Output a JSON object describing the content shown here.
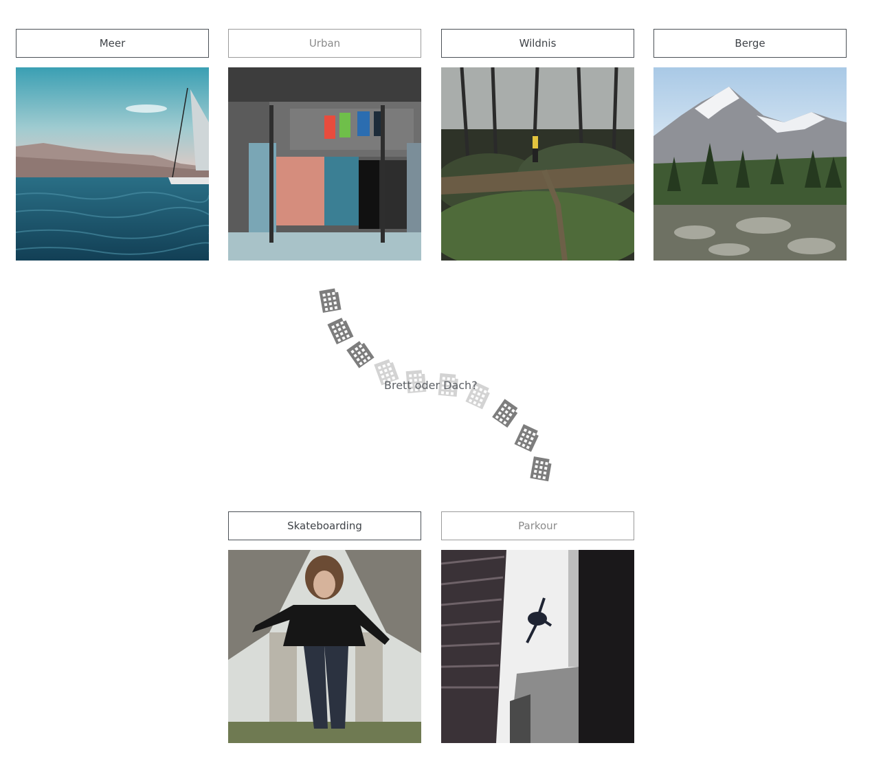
{
  "categories": {
    "meer": {
      "label": "Meer",
      "state": "active"
    },
    "urban": {
      "label": "Urban",
      "state": "muted"
    },
    "wildnis": {
      "label": "Wildnis",
      "state": "active"
    },
    "berge": {
      "label": "Berge",
      "state": "active"
    },
    "skate": {
      "label": "Skateboarding",
      "state": "active"
    },
    "parkour": {
      "label": "Parkour",
      "state": "muted"
    }
  },
  "question": "Brett oder Dach?",
  "loader": {
    "icon": "building-icon",
    "count": 10,
    "active_color": "#7d7d7d",
    "faded_color": "#d3d3d3"
  },
  "colors": {
    "border": "#4a4f55",
    "text": "#3e4247",
    "muted": "#8a8a8a"
  }
}
